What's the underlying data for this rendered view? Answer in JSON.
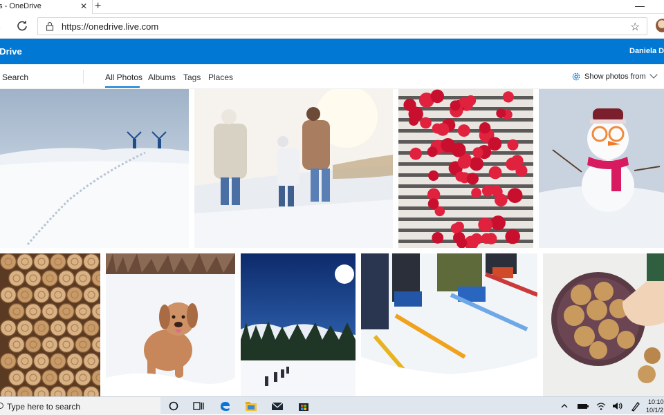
{
  "browser": {
    "tab_title": "es - OneDrive",
    "tab_close": "✕",
    "new_tab": "+",
    "url": "https://onedrive.live.com",
    "star": "☆"
  },
  "app": {
    "title": "eDrive",
    "user": "Daniela Du"
  },
  "subnav": {
    "search": "Search",
    "tabs": [
      "All Photos",
      "Albums",
      "Tags",
      "Places"
    ],
    "active_tab": "All Photos",
    "filter": "Show photos from"
  },
  "colors": {
    "brand": "#0078d4",
    "taskbar": "#dfe6ee"
  },
  "photos": [
    {
      "name": "snow-hikers-photo",
      "subject": "two hikers in snowy field"
    },
    {
      "name": "family-walk-photo",
      "subject": "family walking in snow"
    },
    {
      "name": "cranberries-photo",
      "subject": "cranberries on striped cloth"
    },
    {
      "name": "snowman-photo",
      "subject": "snowman with glasses and scarf"
    },
    {
      "name": "log-pile-photo",
      "subject": "stacked logs"
    },
    {
      "name": "dog-snow-photo",
      "subject": "dog running in snow"
    },
    {
      "name": "ski-trek-photo",
      "subject": "people trekking on snow under blue sky"
    },
    {
      "name": "skis-photo",
      "subject": "kids' skis in snow"
    },
    {
      "name": "cookies-photo",
      "subject": "plate of cookies"
    }
  ],
  "taskbar": {
    "search_placeholder": "Type here to search",
    "time": "10:10",
    "date": "10/1/2"
  },
  "icons": [
    "back-icon",
    "refresh-icon",
    "lock-icon",
    "star-icon",
    "gear-icon",
    "chevron-down-icon",
    "cortana-icon",
    "task-view-icon",
    "edge-icon",
    "file-explorer-icon",
    "mail-icon",
    "store-icon",
    "tray-chevron-icon",
    "battery-icon",
    "wifi-icon",
    "volume-icon",
    "pen-icon"
  ]
}
